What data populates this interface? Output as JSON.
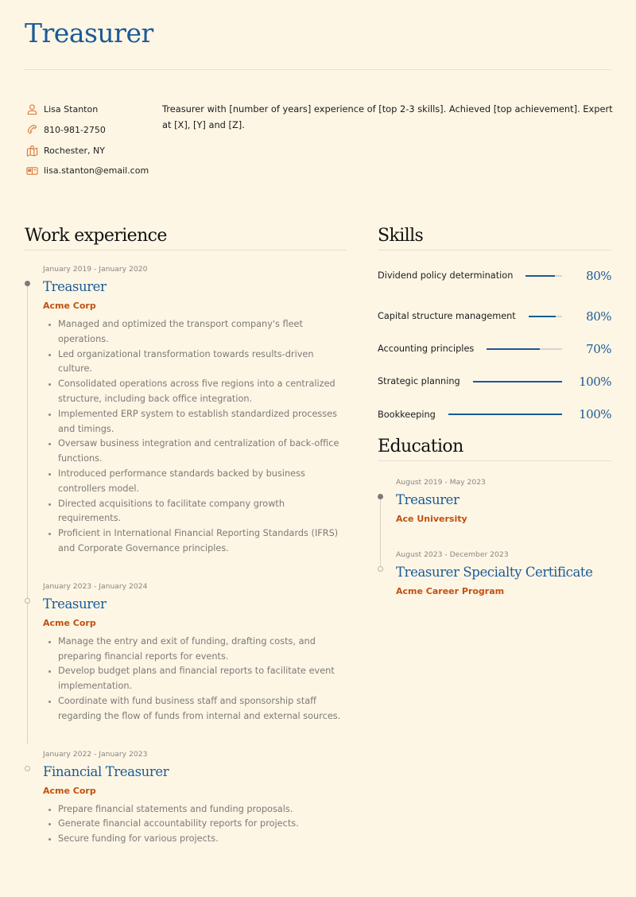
{
  "header": {
    "title": "Treasurer"
  },
  "contact": {
    "name": {
      "icon": "user-icon",
      "text": "Lisa Stanton"
    },
    "phone": {
      "icon": "phone-icon",
      "text": "810-981-2750"
    },
    "location": {
      "icon": "map-icon",
      "text": "Rochester, NY"
    },
    "email": {
      "icon": "mailbox-icon",
      "text": "lisa.stanton@email.com"
    }
  },
  "summary": "Treasurer with [number of years] experience of [top 2-3 skills]. Achieved [top achievement]. Expert at [X], [Y] and [Z].",
  "colors": {
    "accent": "#1a5a96",
    "organization": "#c4500f",
    "icon": "#e07a3c",
    "background": "#fdf6e5"
  },
  "work": {
    "title": "Work experience",
    "entries": [
      {
        "date": "January 2019 - January 2020",
        "title": "Treasurer",
        "org": "Acme Corp",
        "bullets": [
          "Managed and optimized the transport company's fleet operations.",
          "Led organizational transformation towards results-driven culture.",
          "Consolidated operations across five regions into a centralized structure, including back office integration.",
          "Implemented ERP system to establish standardized processes and timings.",
          "Oversaw business integration and centralization of back-office functions.",
          "Introduced performance standards backed by business controllers model.",
          "Directed acquisitions to facilitate company growth requirements.",
          "Proficient in International Financial Reporting Standards (IFRS) and Corporate Governance principles."
        ]
      },
      {
        "date": "January 2023 - January 2024",
        "title": "Treasurer",
        "org": "Acme Corp",
        "bullets": [
          "Manage the entry and exit of funding, drafting costs, and preparing financial reports for events.",
          "Develop budget plans and financial reports to facilitate event implementation.",
          "Coordinate with fund business staff and sponsorship staff regarding the flow of funds from internal and external sources."
        ]
      },
      {
        "date": "January 2022 - January 2023",
        "title": "Financial Treasurer",
        "org": "Acme Corp",
        "bullets": [
          "Prepare financial statements and funding proposals.",
          "Generate financial accountability reports for projects.",
          "Secure funding for various projects."
        ]
      }
    ]
  },
  "skills": {
    "title": "Skills",
    "items": [
      {
        "name": "Dividend policy determination",
        "level": 80,
        "label": "80%"
      },
      {
        "name": "Capital structure management",
        "level": 80,
        "label": "80%"
      },
      {
        "name": "Accounting principles",
        "level": 70,
        "label": "70%"
      },
      {
        "name": "Strategic planning",
        "level": 100,
        "label": "100%"
      },
      {
        "name": "Bookkeeping",
        "level": 100,
        "label": "100%"
      }
    ]
  },
  "education": {
    "title": "Education",
    "entries": [
      {
        "date": "August 2019 - May 2023",
        "title": "Treasurer",
        "org": "Ace University"
      },
      {
        "date": "August 2023 - December 2023",
        "title": "Treasurer Specialty Certificate",
        "org": "Acme Career Program"
      }
    ]
  }
}
